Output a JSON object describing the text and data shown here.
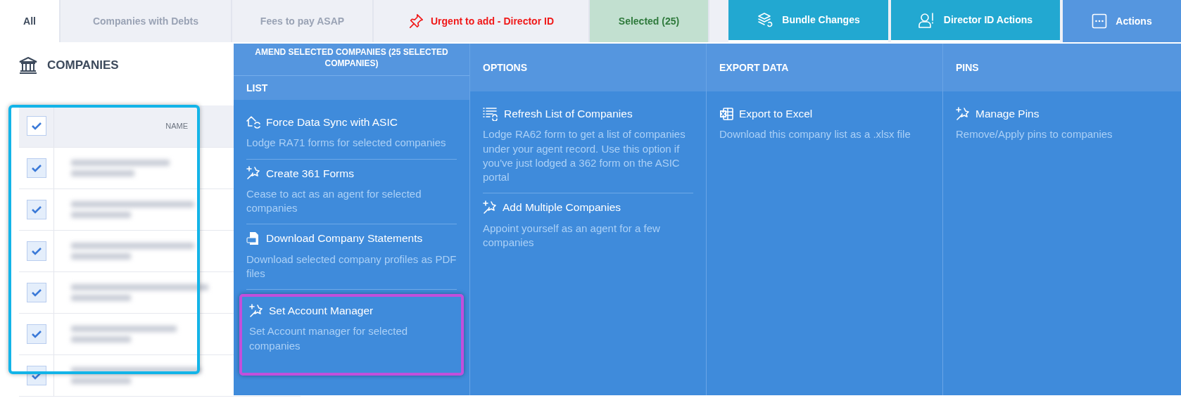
{
  "tabs": [
    {
      "label": "All",
      "kind": "filter",
      "selected": true
    },
    {
      "label": "Companies with Debts",
      "kind": "filter",
      "selected": false
    },
    {
      "label": "Fees to pay ASAP",
      "kind": "filter",
      "selected": false
    },
    {
      "label": "Urgent to add - Director ID",
      "kind": "urgent",
      "selected": false
    },
    {
      "label": "Selected (25)",
      "kind": "selection",
      "selected": false
    }
  ],
  "action_tabs": [
    {
      "label": "Bundle Changes",
      "open": false
    },
    {
      "label": "Director ID Actions",
      "open": false
    },
    {
      "label": "Actions",
      "open": true
    }
  ],
  "companies": {
    "heading": "COMPANIES",
    "column": "NAME",
    "all_checked": true,
    "selection_outlined": true,
    "rows": [
      {
        "checked": true
      },
      {
        "checked": true
      },
      {
        "checked": true
      },
      {
        "checked": true
      },
      {
        "checked": true
      },
      {
        "checked": true
      }
    ]
  },
  "menu": {
    "title": "AMEND SELECTED COMPANIES (25 SELECTED COMPANIES)",
    "columns": [
      {
        "heading": "LIST",
        "items": [
          {
            "title": "Force Data Sync with ASIC",
            "description": "Lodge RA71 forms for selected companies",
            "highlighted": false
          },
          {
            "title": "Create 361 Forms",
            "description": "Cease to act as an agent for selected companies",
            "highlighted": false
          },
          {
            "title": "Download Company Statements",
            "description": "Download selected company profiles as PDF files",
            "highlighted": false
          },
          {
            "title": "Set Account Manager",
            "description": "Set Account manager for selected companies",
            "highlighted": true
          }
        ]
      },
      {
        "heading": "OPTIONS",
        "items": [
          {
            "title": "Refresh List of Companies",
            "description": "Lodge RA62 form to get a list of companies under your agent record. Use this option if you've just lodged a 362 form on the ASIC portal",
            "highlighted": false
          },
          {
            "title": "Add Multiple Companies",
            "description": "Appoint yourself as an agent for a few companies",
            "highlighted": false
          }
        ]
      },
      {
        "heading": "EXPORT DATA",
        "items": [
          {
            "title": "Export to Excel",
            "description": "Download this company list as a .xlsx file",
            "highlighted": false
          }
        ]
      },
      {
        "heading": "PINS",
        "items": [
          {
            "title": "Manage Pins",
            "description": "Remove/Apply pins to companies",
            "highlighted": false
          }
        ]
      }
    ]
  }
}
